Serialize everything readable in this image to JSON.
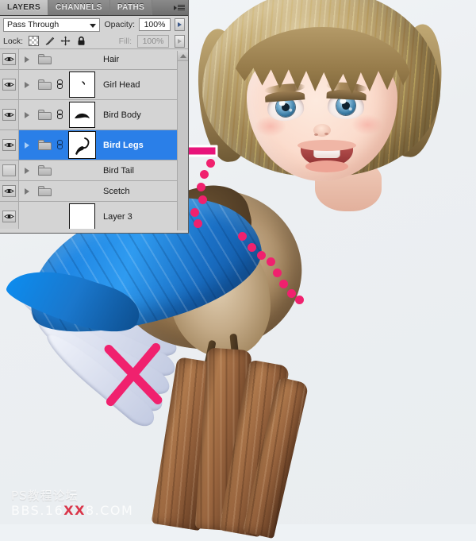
{
  "panel": {
    "tabs": [
      {
        "label": "LAYERS",
        "active": true
      },
      {
        "label": "CHANNELS",
        "active": false
      },
      {
        "label": "PATHS",
        "active": false
      }
    ],
    "menu_icon": "panel-menu-icon",
    "blend_mode": {
      "value": "Pass Through",
      "caret_icon": "chevron-down-icon"
    },
    "opacity": {
      "label": "Opacity:",
      "value": "100%"
    },
    "fill": {
      "label": "Fill:",
      "value": "100%"
    },
    "lock": {
      "label": "Lock:",
      "items": [
        {
          "name": "lock-transparent-pixels-icon"
        },
        {
          "name": "lock-image-pixels-icon"
        },
        {
          "name": "lock-position-icon"
        },
        {
          "name": "lock-all-icon"
        }
      ]
    },
    "layers": [
      {
        "name": "Hair",
        "visible": true,
        "group": true,
        "expand": true,
        "linked": false,
        "thumb": "none",
        "selected": false
      },
      {
        "name": "Girl Head",
        "visible": true,
        "group": true,
        "expand": true,
        "linked": true,
        "thumb": "girl-head",
        "selected": false
      },
      {
        "name": "Bird Body",
        "visible": true,
        "group": true,
        "expand": true,
        "linked": true,
        "thumb": "bird-body",
        "selected": false
      },
      {
        "name": "Bird Legs",
        "visible": true,
        "group": true,
        "expand": true,
        "linked": true,
        "thumb": "bird-legs",
        "selected": true
      },
      {
        "name": "Bird Tail",
        "visible": false,
        "group": true,
        "expand": true,
        "linked": false,
        "thumb": "none",
        "selected": false
      },
      {
        "name": "Scetch",
        "visible": true,
        "group": true,
        "expand": true,
        "linked": false,
        "thumb": "none",
        "selected": false
      },
      {
        "name": "Layer 3",
        "visible": true,
        "group": false,
        "expand": false,
        "linked": false,
        "thumb": "blank",
        "selected": false
      }
    ],
    "scrollbar": {
      "up_icon": "scroll-up-icon"
    }
  },
  "annotations": {
    "arrow": {
      "name": "pointer-arrow",
      "color": "#E8147A",
      "points_to": "Bird Legs"
    },
    "cross": {
      "name": "cross-out-mark",
      "color": "#F0216E",
      "marks": "bird-tail-feathers"
    },
    "dotted_line": {
      "name": "dotted-outline",
      "color": "#F0216E",
      "dots": 14
    }
  },
  "artwork": {
    "description": "Girl head composited onto a blue bird perched on a tree branch",
    "colors": {
      "wing_blue": "#1F86E3",
      "hair_blonde": "#9C8352",
      "branch_brown": "#98643E",
      "background": "#EEF2F5"
    }
  },
  "watermark": {
    "line1": "PS教程论坛",
    "line2_prefix": "BBS",
    "line2_dot1": ".16",
    "line2_highlight": "XX",
    "line2_suffix": "8",
    "line2_dot2": ".COM"
  }
}
